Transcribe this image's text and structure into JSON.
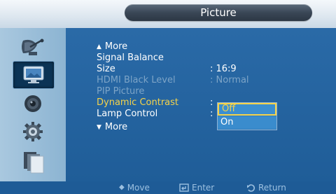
{
  "title": "Picture",
  "sidebar": {
    "icons": [
      {
        "name": "satellite-dish-icon"
      },
      {
        "name": "picture-icon",
        "active": true
      },
      {
        "name": "speaker-icon"
      },
      {
        "name": "gear-icon"
      },
      {
        "name": "documents-icon"
      }
    ]
  },
  "menu": {
    "more_up": "More",
    "items": [
      {
        "label": "Signal Balance",
        "value": ""
      },
      {
        "label": "Size",
        "value": ": 16:9"
      },
      {
        "label": "HDMI Black Level",
        "value": ": Normal"
      },
      {
        "label": "PIP Picture",
        "value": ""
      },
      {
        "label": "Dynamic Contrast",
        "value": ":"
      },
      {
        "label": "Lamp Control",
        "value": ":"
      }
    ],
    "more_down": "More"
  },
  "dropdown": {
    "options": [
      "Off",
      "On"
    ],
    "selected": "Off"
  },
  "bottom": {
    "move": "Move",
    "enter": "Enter",
    "return": "Return"
  }
}
